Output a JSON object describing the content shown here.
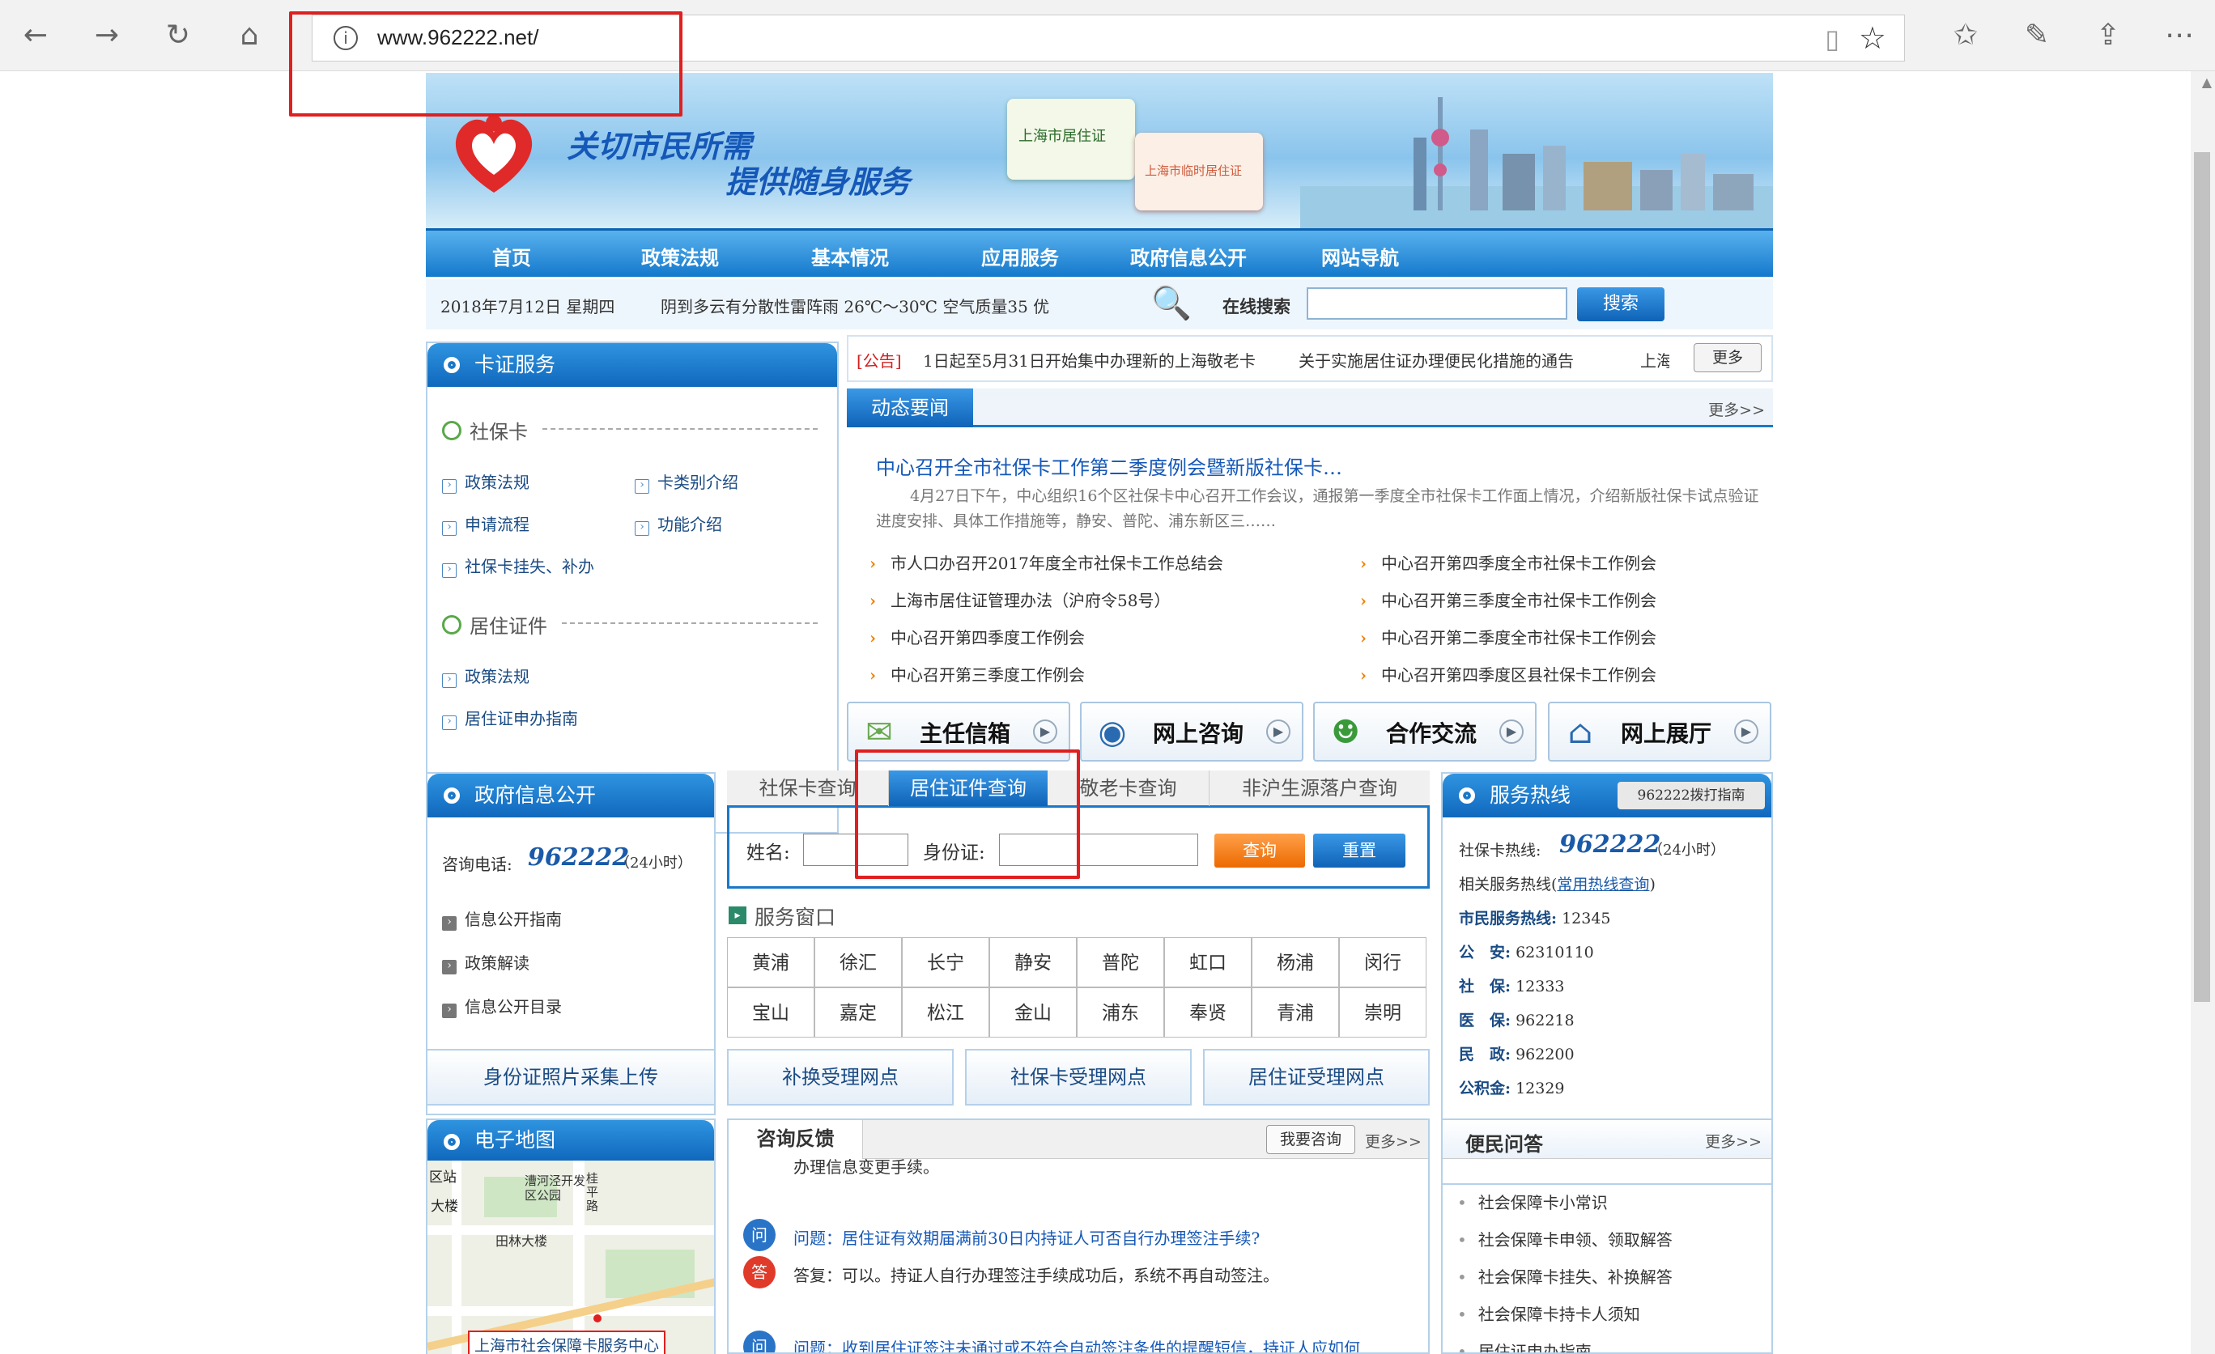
{
  "browser": {
    "url": "www.962222.net/"
  },
  "site": {
    "slogan_line1": "关切市民所需",
    "slogan_line2": "提供随身服务",
    "card1": "上海市居住证",
    "card2": "上海市临时居住证",
    "nav": [
      "首页",
      "政策法规",
      "基本情况",
      "应用服务",
      "政府信息公开",
      "网站导航"
    ],
    "info": {
      "date": "2018年7月12日 星期四",
      "weather": "阴到多云有分散性雷阵雨 26℃～30℃ 空气质量35 优",
      "search_label": "在线搜索",
      "search_button": "搜索"
    },
    "card_service": {
      "title": "卡证服务",
      "sec1": "社保卡",
      "sec1_links": [
        "政策法规",
        "卡类别介绍",
        "申请流程",
        "功能介绍",
        "社保卡挂失、补办"
      ],
      "sec2": "居住证件",
      "sec2_links": [
        "政策法规",
        "居住证申办指南"
      ]
    },
    "notice": {
      "tag": "[公告]",
      "items": [
        "1日起至5月31日开始集中办理新的上海敬老卡",
        "关于实施居住证办理便民化措施的通告",
        "上海"
      ],
      "more": "更多"
    },
    "news": {
      "tab": "动态要闻",
      "more": "更多>>",
      "headline": "中心召开全市社保卡工作第二季度例会暨新版社保卡…",
      "summary": "4月27日下午，中心组织16个区社保卡中心召开工作会议，通报第一季度全市社保卡工作面上情况，介绍新版社保卡试点验证进度安排、具体工作措施等，静安、普陀、浦东新区三……",
      "left": [
        "市人口办召开2017年度全市社保卡工作总结会",
        "上海市居住证管理办法（沪府令58号）",
        "中心召开第四季度工作例会",
        "中心召开第三季度工作例会"
      ],
      "right": [
        "中心召开第四季度全市社保卡工作例会",
        "中心召开第三季度全市社保卡工作例会",
        "中心召开第二季度全市社保卡工作例会",
        "中心召开第四季度区县社保卡工作例会"
      ]
    },
    "quick_buttons": [
      "主任信箱",
      "网上咨询",
      "合作交流",
      "网上展厅"
    ],
    "gov_info": {
      "title": "政府信息公开",
      "phone_label": "咨询电话:",
      "phone": "962222",
      "phone_note": "（24小时）",
      "links": [
        "信息公开指南",
        "政策解读",
        "信息公开目录"
      ]
    },
    "query": {
      "tabs": [
        "社保卡查询",
        "居住证件查询",
        "敬老卡查询",
        "非沪生源落户查询"
      ],
      "name_label": "姓名:",
      "id_label": "身份证:",
      "query_button": "查询",
      "reset_button": "重置",
      "service_window": "服务窗口",
      "districts": [
        "黄浦",
        "徐汇",
        "长宁",
        "静安",
        "普陀",
        "虹口",
        "杨浦",
        "闵行",
        "宝山",
        "嘉定",
        "松江",
        "金山",
        "浦东",
        "奉贤",
        "青浦",
        "崇明"
      ]
    },
    "hotline": {
      "title": "服务热线",
      "guide": "962222拨打指南",
      "card_label": "社保卡热线:",
      "card_number": "962222",
      "card_note": "（24小时）",
      "related_label": "相关服务热线(",
      "related_link": "常用热线查询",
      "related_close": ")",
      "lines": [
        {
          "label": "市民服务热线:",
          "value": "12345"
        },
        {
          "label": "公　安:",
          "value": "62310110"
        },
        {
          "label": "社　保:",
          "value": "12333"
        },
        {
          "label": "医　保:",
          "value": "962218"
        },
        {
          "label": "民　政:",
          "value": "962200"
        },
        {
          "label": "公积金:",
          "value": "12329"
        }
      ]
    },
    "bottom_buttons": [
      "身份证照片采集上传",
      "补换受理网点",
      "社保卡受理网点",
      "居住证受理网点"
    ],
    "map": {
      "title": "电子地图",
      "labels": [
        "区站",
        "漕河泾开发区公园",
        "大楼",
        "桂平路",
        "田林大楼",
        "上海市社会保障卡服务中心"
      ]
    },
    "consult": {
      "tab": "咨询反馈",
      "ask_button": "我要咨询",
      "more": "更多>>",
      "cut_text": "办理信息变更手续。",
      "q1": "问题：居住证有效期届满前30日内持证人可否自行办理签注手续?",
      "a1": "答复：可以。持证人自行办理签注手续成功后，系统不再自动签注。",
      "q2": "问题：收到居住证签注未通过或不符合自动签注条件的提醒短信，持证人应如何",
      "q_icon": "问",
      "a_icon": "答"
    },
    "faq": {
      "title": "便民问答",
      "more": "更多>>",
      "items": [
        "社会保障卡小常识",
        "社会保障卡申领、领取解答",
        "社会保障卡挂失、补换解答",
        "社会保障卡持卡人须知",
        "居住证申办指南"
      ]
    }
  }
}
